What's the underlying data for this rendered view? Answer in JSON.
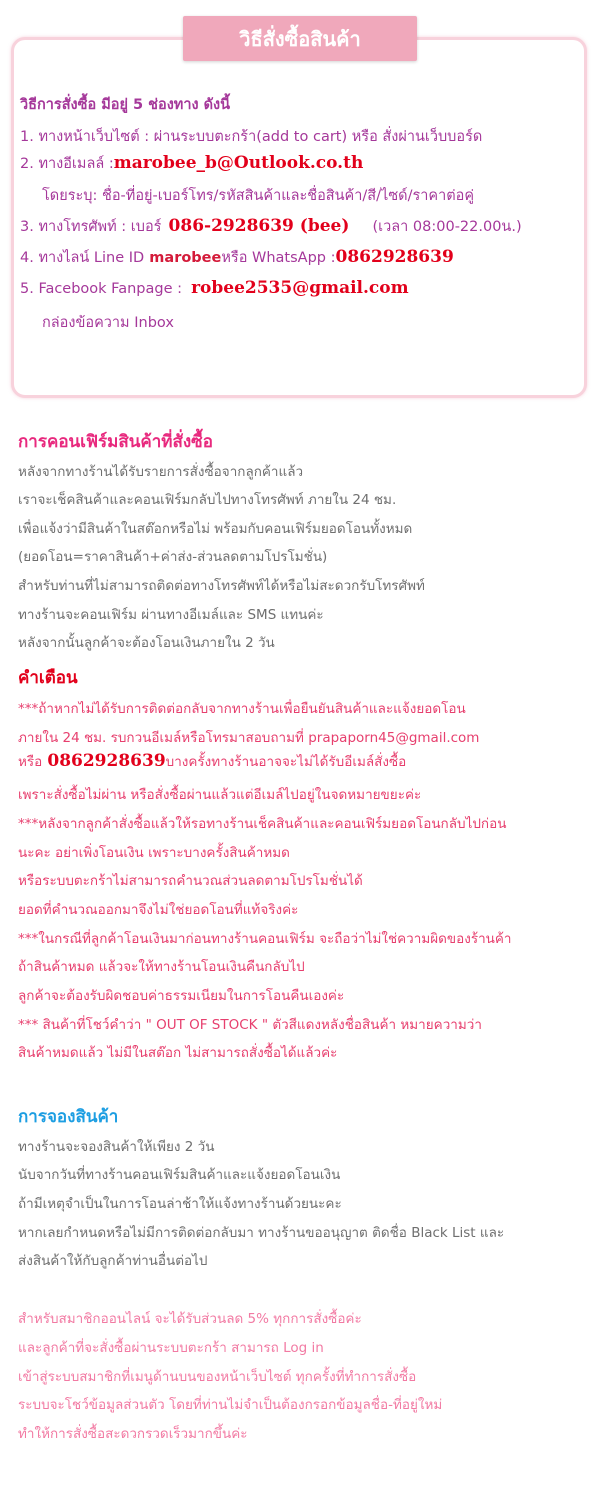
{
  "box": {
    "title": "วิธีสั่งซื้อสินค้า",
    "intro": "วิธีการสั่งซื้อ   มีอยู่ 5 ช่องทาง  ดังนี้",
    "item1": "1. ทางหน้าเว็บไซต์ : ผ่านระบบตะกร้า(add to cart) หรือ สั่งผ่านเว็บบอร์ด",
    "item2_label": "2. ทางอีเมลล์ :",
    "item2_email": "marobee_b@Outlook.co.th",
    "item2_note": "โดยระบุ: ชื่อ-ที่อยู่-เบอร์โทร/รหัสสินค้าและชื่อสินค้า/สี/ไซด์/ราคาต่อคู่",
    "item3_label": "3. ทางโทรศัพท์ : เบอร์",
    "item3_phone": "086-2928639 (bee)",
    "item3_time": "(เวลา 08:00-22.00น.)",
    "item4_label": "4. ทางไลน์   Line ID",
    "item4_line": "marobee",
    "item4_mid": "หรือ WhatsApp :",
    "item4_phone": "0862928639",
    "item5_label": "5. Facebook Fanpage :",
    "item5_email": "robee2535@gmail.com",
    "item5_note": "กล่องข้อความ Inbox"
  },
  "confirm": {
    "heading": "การคอนเฟิร์มสินค้าที่สั่งซื้อ",
    "lines": [
      "หลังจากทางร้านได้รับรายการสั่งซื้อจากลูกค้าแล้ว",
      "เราจะเช็คสินค้าและคอนเฟิร์มกลับไปทางโทรศัพท์ ภายใน 24 ชม.",
      "เพื่อแจ้งว่ามีสินค้าในสต๊อกหรือไม่ พร้อมกับคอนเฟิร์มยอดโอนทั้งหมด",
      "(ยอดโอน=ราคาสินค้า+ค่าส่ง-ส่วนลดตามโปรโมชั่น)",
      "สำหรับท่านที่ไม่สามารถติดต่อทางโทรศัพท์ได้หรือไม่สะดวกรับโทรศัพท์",
      "ทางร้านจะคอนเฟิร์ม ผ่านทางอีเมล์และ SMS แทนค่ะ",
      "หลังจากนั้นลูกค้าจะต้องโอนเงินภายใน 2 วัน"
    ]
  },
  "warning": {
    "heading": "คำเตือน",
    "line1": "***ถ้าหากไม่ได้รับการติดต่อกลับจากทางร้านเพื่อยืนยันสินค้าและแจ้งยอดโอน",
    "line2": "ภายใน 24 ชม. รบกวนอีเมล์หรือโทรมาสอบถามที่ prapaporn45@gmail.com",
    "line3_a": "หรือ",
    "line3_phone": "0862928639",
    "line3_b": "บางครั้งทางร้านอาจจะไม่ได้รับอีเมล์สั่งซื้อ",
    "line4": "เพราะสั่งซื้อไม่ผ่าน หรือสั่งซื้อผ่านแล้วแต่อีเมล์ไปอยู่ในจดหมายขยะค่ะ",
    "line5": "***หลังจากลูกค้าสั่งซื้อแล้วให้รอทางร้านเช็คสินค้าและคอนเฟิร์มยอดโอนกลับไปก่อน",
    "line6": "นะคะ อย่าเพิ่งโอนเงิน เพราะบางครั้งสินค้าหมด",
    "line7": "หรือระบบตะกร้าไม่สามารถคำนวณส่วนลดตามโปรโมชั่นได้",
    "line8": "ยอดที่คำนวณออกมาจึงไม่ใช่ยอดโอนที่แท้จริงค่ะ",
    "line9": "***ในกรณีที่ลูกค้าโอนเงินมาก่อนทางร้านคอนเฟิร์ม จะถือว่าไม่ใช่ความผิดของร้านค้า",
    "line10": "ถ้าสินค้าหมด แล้วจะให้ทางร้านโอนเงินคืนกลับไป",
    "line11": "ลูกค้าจะต้องรับผิดชอบค่าธรรมเนียมในการโอนคืนเองค่ะ",
    "line12": "  *** สินค้าที่โชว์คำว่า \" OUT OF STOCK \" ตัวสีแดงหลังชื่อสินค้า หมายความว่า",
    "line13": "สินค้าหมดแล้ว ไม่มีในสต๊อก ไม่สามารถสั่งซื้อได้แล้วค่ะ"
  },
  "reserve": {
    "heading": "การจองสินค้า",
    "lines": [
      "ทางร้านจะจองสินค้าให้เพียง 2 วัน",
      "นับจากวันที่ทางร้านคอนเฟิร์มสินค้าและแจ้งยอดโอนเงิน",
      "ถ้ามีเหตุจำเป็นในการโอนล่าช้าให้แจ้งทางร้านด้วยนะคะ",
      "หากเลยกำหนดหรือไม่มีการติดต่อกลับมา ทางร้านขออนุญาต ติดชื่อ Black List และ",
      "ส่งสินค้าให้กับลูกค้าท่านอื่นต่อไป"
    ]
  },
  "member": {
    "lines": [
      "สำหรับสมาชิกออนไลน์ จะได้รับส่วนลด 5% ทุกการสั่งซื้อค่ะ",
      "และลูกค้าที่จะสั่งซื้อผ่านระบบตะกร้า สามารถ Log in",
      "เข้าสู่ระบบสมาชิกที่เมนูด้านบนของหน้าเว็บไซต์ ทุกครั้งที่ทำการสั่งซื้อ",
      "ระบบจะโชว์ข้อมูลส่วนตัว โดยที่ท่านไม่จำเป็นต้องกรอกข้อมูลชื่อ-ที่อยู่ใหม่",
      "ทำให้การสั่งซื้อสะดวกรวดเร็วมากขึ้นค่ะ"
    ]
  }
}
